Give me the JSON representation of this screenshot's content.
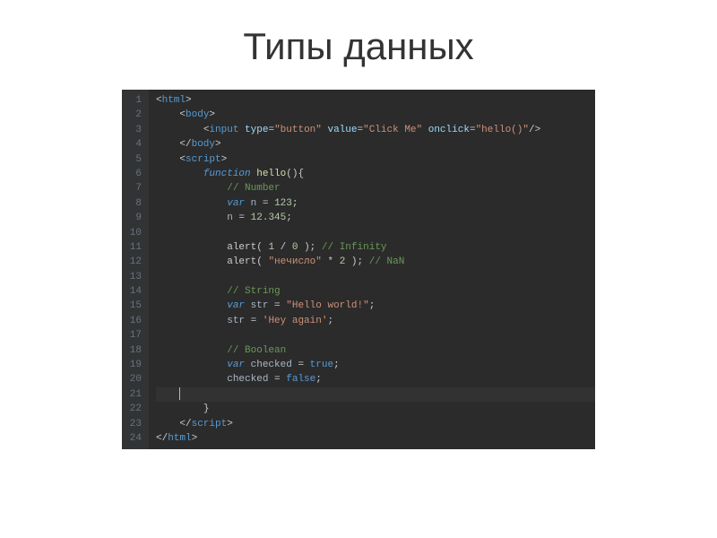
{
  "title": "Типы данных",
  "editor": {
    "line_count": 24,
    "cursor_line_index": 20,
    "lines": [
      {
        "indent": 0,
        "tokens": [
          [
            "punct",
            "<"
          ],
          [
            "tag",
            "html"
          ],
          [
            "punct",
            ">"
          ]
        ]
      },
      {
        "indent": 1,
        "tokens": [
          [
            "punct",
            "<"
          ],
          [
            "tag",
            "body"
          ],
          [
            "punct",
            ">"
          ]
        ]
      },
      {
        "indent": 2,
        "tokens": [
          [
            "punct",
            "<"
          ],
          [
            "tag",
            "input"
          ],
          [
            "ident",
            " "
          ],
          [
            "attr",
            "type"
          ],
          [
            "op",
            "="
          ],
          [
            "str",
            "\"button\""
          ],
          [
            "ident",
            " "
          ],
          [
            "attr",
            "value"
          ],
          [
            "op",
            "="
          ],
          [
            "str",
            "\"Click Me\""
          ],
          [
            "ident",
            " "
          ],
          [
            "attr",
            "onclick"
          ],
          [
            "op",
            "="
          ],
          [
            "str",
            "\"hello()\""
          ],
          [
            "punct",
            "/>"
          ]
        ]
      },
      {
        "indent": 1,
        "tokens": [
          [
            "punct",
            "</"
          ],
          [
            "tag",
            "body"
          ],
          [
            "punct",
            ">"
          ]
        ]
      },
      {
        "indent": 1,
        "tokens": [
          [
            "punct",
            "<"
          ],
          [
            "tag",
            "script"
          ],
          [
            "punct",
            ">"
          ]
        ]
      },
      {
        "indent": 2,
        "tokens": [
          [
            "kw",
            "function"
          ],
          [
            "ident",
            " "
          ],
          [
            "fname",
            "hello"
          ],
          [
            "punct",
            "(){"
          ]
        ]
      },
      {
        "indent": 3,
        "tokens": [
          [
            "cmt",
            "// Number"
          ]
        ]
      },
      {
        "indent": 3,
        "tokens": [
          [
            "kw",
            "var"
          ],
          [
            "ident",
            " n "
          ],
          [
            "op",
            "="
          ],
          [
            "ident",
            " "
          ],
          [
            "num",
            "123"
          ],
          [
            "punct",
            ";"
          ]
        ]
      },
      {
        "indent": 3,
        "tokens": [
          [
            "ident",
            "n "
          ],
          [
            "op",
            "="
          ],
          [
            "ident",
            " "
          ],
          [
            "num",
            "12.345"
          ],
          [
            "punct",
            ";"
          ]
        ]
      },
      {
        "indent": 0,
        "tokens": []
      },
      {
        "indent": 3,
        "tokens": [
          [
            "call",
            "alert"
          ],
          [
            "punct",
            "( "
          ],
          [
            "num",
            "1"
          ],
          [
            "ident",
            " "
          ],
          [
            "op",
            "/"
          ],
          [
            "ident",
            " "
          ],
          [
            "num",
            "0"
          ],
          [
            "punct",
            " );"
          ],
          [
            "ident",
            " "
          ],
          [
            "cmt",
            "// Infinity"
          ]
        ]
      },
      {
        "indent": 3,
        "tokens": [
          [
            "call",
            "alert"
          ],
          [
            "punct",
            "( "
          ],
          [
            "str",
            "\"нечисло\""
          ],
          [
            "ident",
            " "
          ],
          [
            "op",
            "*"
          ],
          [
            "ident",
            " "
          ],
          [
            "num",
            "2"
          ],
          [
            "punct",
            " );"
          ],
          [
            "ident",
            " "
          ],
          [
            "cmt",
            "// NaN"
          ]
        ]
      },
      {
        "indent": 0,
        "tokens": []
      },
      {
        "indent": 3,
        "tokens": [
          [
            "cmt",
            "// String"
          ]
        ]
      },
      {
        "indent": 3,
        "tokens": [
          [
            "kw",
            "var"
          ],
          [
            "ident",
            " str "
          ],
          [
            "op",
            "="
          ],
          [
            "ident",
            " "
          ],
          [
            "str",
            "\"Hello world!\""
          ],
          [
            "punct",
            ";"
          ]
        ]
      },
      {
        "indent": 3,
        "tokens": [
          [
            "ident",
            "str "
          ],
          [
            "op",
            "="
          ],
          [
            "ident",
            " "
          ],
          [
            "str",
            "'Hey again'"
          ],
          [
            "punct",
            ";"
          ]
        ]
      },
      {
        "indent": 0,
        "tokens": []
      },
      {
        "indent": 3,
        "tokens": [
          [
            "cmt",
            "// Boolean"
          ]
        ]
      },
      {
        "indent": 3,
        "tokens": [
          [
            "kw",
            "var"
          ],
          [
            "ident",
            " checked "
          ],
          [
            "op",
            "="
          ],
          [
            "ident",
            " "
          ],
          [
            "bool",
            "true"
          ],
          [
            "punct",
            ";"
          ]
        ]
      },
      {
        "indent": 3,
        "tokens": [
          [
            "ident",
            "checked "
          ],
          [
            "op",
            "="
          ],
          [
            "ident",
            " "
          ],
          [
            "bool",
            "false"
          ],
          [
            "punct",
            ";"
          ]
        ]
      },
      {
        "indent": 0,
        "tokens": [],
        "cursor": true
      },
      {
        "indent": 2,
        "tokens": [
          [
            "punct",
            "}"
          ]
        ]
      },
      {
        "indent": 1,
        "tokens": [
          [
            "punct",
            "</"
          ],
          [
            "tag",
            "script"
          ],
          [
            "punct",
            ">"
          ]
        ]
      },
      {
        "indent": 0,
        "tokens": [
          [
            "punct",
            "</"
          ],
          [
            "tag",
            "html"
          ],
          [
            "punct",
            ">"
          ]
        ]
      }
    ]
  }
}
